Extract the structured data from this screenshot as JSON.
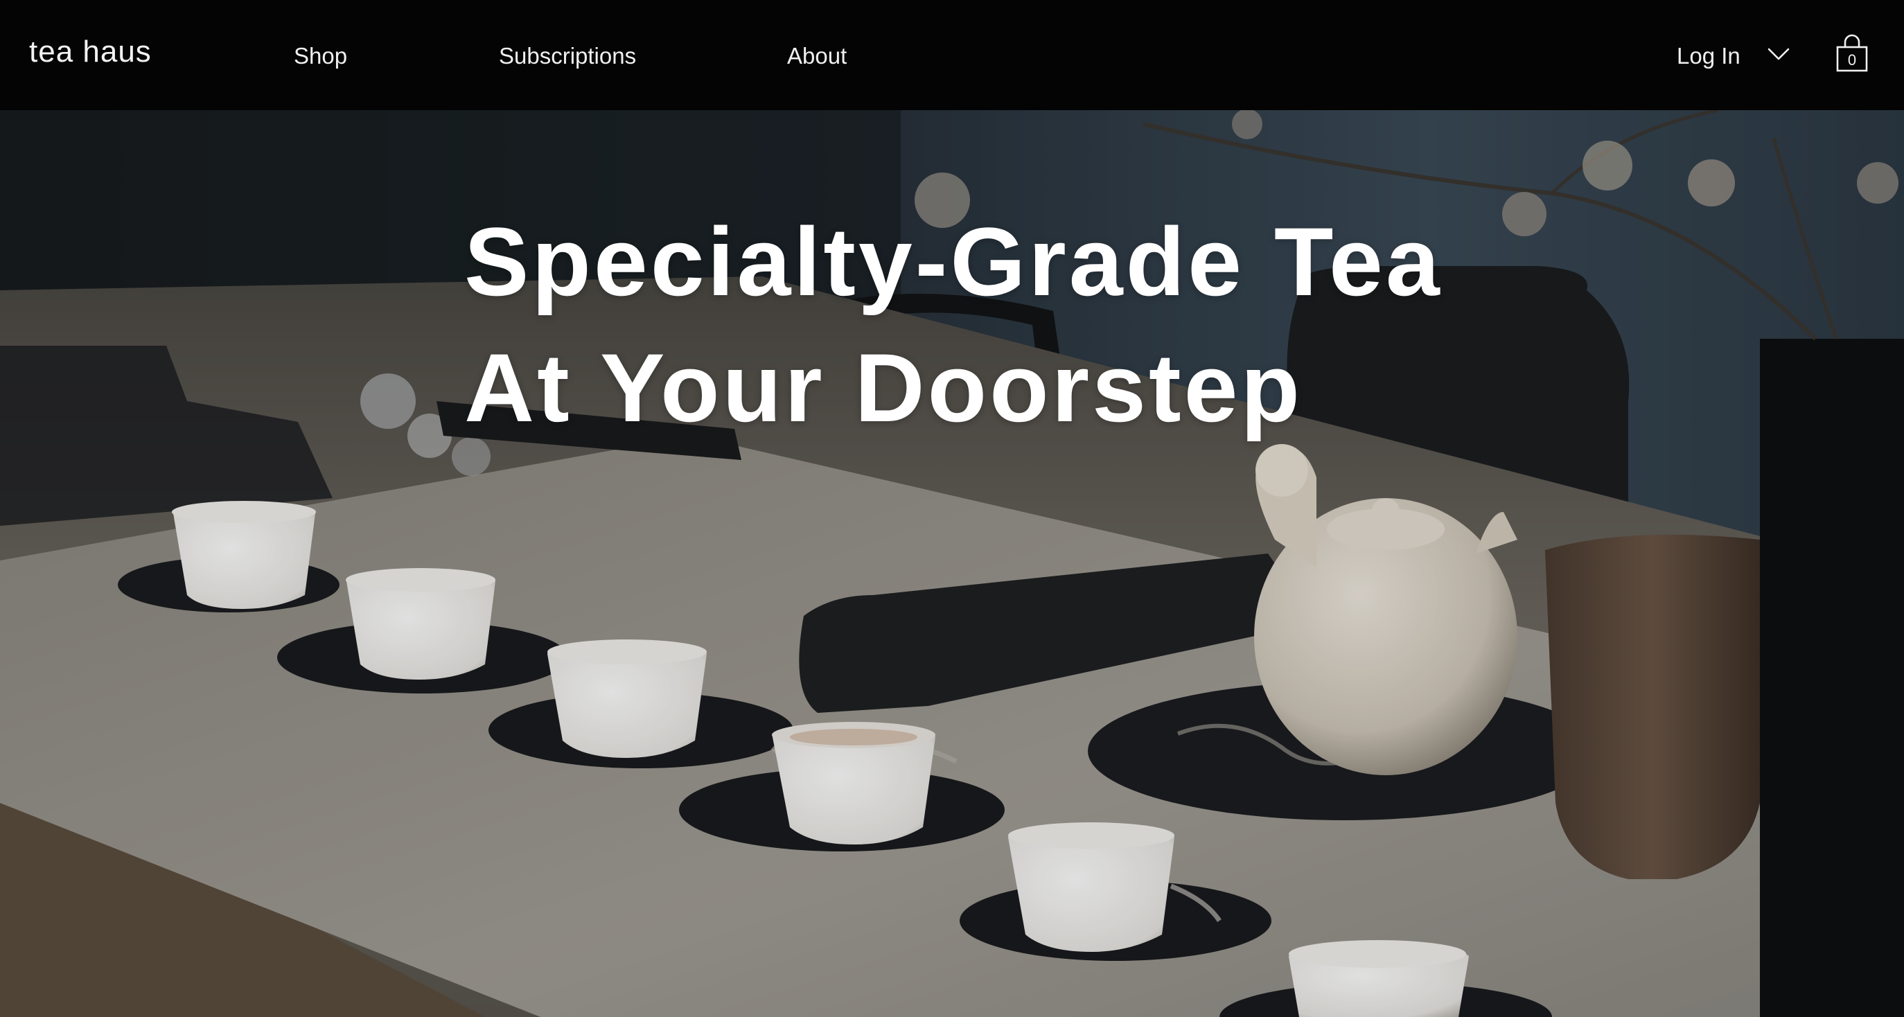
{
  "brand": {
    "name": "tea haus"
  },
  "nav": {
    "items": [
      {
        "label": "Shop"
      },
      {
        "label": "Subscriptions"
      },
      {
        "label": "About"
      }
    ]
  },
  "account": {
    "login_label": "Log In",
    "cart_count": "0"
  },
  "hero": {
    "title_line1": "Specialty-Grade Tea",
    "title_line2": "At Your Doorstep"
  },
  "icons": {
    "login_dropdown": "chevron-down-icon",
    "cart": "shopping-bag-icon"
  },
  "colors": {
    "header_bg": "#040404",
    "text": "#ffffff"
  }
}
